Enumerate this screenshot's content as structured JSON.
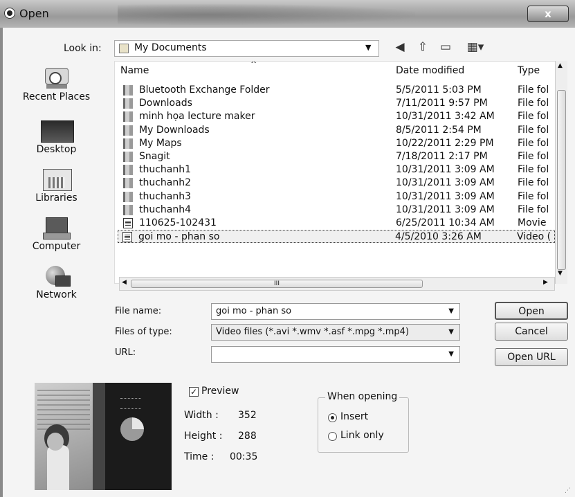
{
  "window": {
    "title": "Open",
    "close_label": "x"
  },
  "look_in": {
    "label": "Look in:",
    "value": "My Documents"
  },
  "toolbar": {
    "icons": [
      "back-icon",
      "up-folder-icon",
      "new-folder-icon",
      "view-menu-icon"
    ]
  },
  "places": [
    {
      "label": "Recent Places",
      "icon": "recent-places-icon"
    },
    {
      "label": "Desktop",
      "icon": "desktop-icon"
    },
    {
      "label": "Libraries",
      "icon": "libraries-icon"
    },
    {
      "label": "Computer",
      "icon": "computer-icon"
    },
    {
      "label": "Network",
      "icon": "network-icon"
    }
  ],
  "file_list": {
    "columns": [
      "Name",
      "Date modified",
      "Type"
    ],
    "rows": [
      {
        "name": "Bluetooth Exchange Folder",
        "date": "5/5/2011 5:03 PM",
        "type": "File fol",
        "kind": "folder"
      },
      {
        "name": "Downloads",
        "date": "7/11/2011 9:57 PM",
        "type": "File fol",
        "kind": "folder"
      },
      {
        "name": "minh họa lecture maker",
        "date": "10/31/2011 3:42 AM",
        "type": "File fol",
        "kind": "folder"
      },
      {
        "name": "My Downloads",
        "date": "8/5/2011 2:54 PM",
        "type": "File fol",
        "kind": "folder"
      },
      {
        "name": "My Maps",
        "date": "10/22/2011 2:29 PM",
        "type": "File fol",
        "kind": "folder"
      },
      {
        "name": "Snagit",
        "date": "7/18/2011 2:17 PM",
        "type": "File fol",
        "kind": "folder"
      },
      {
        "name": "thuchanh1",
        "date": "10/31/2011 3:09 AM",
        "type": "File fol",
        "kind": "folder"
      },
      {
        "name": "thuchanh2",
        "date": "10/31/2011 3:09 AM",
        "type": "File fol",
        "kind": "folder"
      },
      {
        "name": "thuchanh3",
        "date": "10/31/2011 3:09 AM",
        "type": "File fol",
        "kind": "folder"
      },
      {
        "name": "thuchanh4",
        "date": "10/31/2011 3:09 AM",
        "type": "File fol",
        "kind": "folder"
      },
      {
        "name": "110625-102431",
        "date": "6/25/2011 10:34 AM",
        "type": "Movie",
        "kind": "movie"
      },
      {
        "name": "goi mo - phan so",
        "date": "4/5/2010 3:26 AM",
        "type": "Video (",
        "kind": "movie",
        "selected": true
      }
    ],
    "hscroll_grip": "III"
  },
  "fields": {
    "file_name": {
      "label": "File name:",
      "value": "goi mo - phan so"
    },
    "file_type": {
      "label": "Files of type:",
      "value": "Video files (*.avi *.wmv *.asf *.mpg *.mp4)"
    },
    "url": {
      "label": "URL:",
      "value": ""
    }
  },
  "buttons": {
    "open": "Open",
    "cancel": "Cancel",
    "open_url": "Open URL"
  },
  "preview": {
    "checkbox_label": "Preview",
    "checked": true,
    "width_label": "Width :",
    "width_value": "352",
    "height_label": "Height :",
    "height_value": "288",
    "time_label": "Time :",
    "time_value": "00:35"
  },
  "when_opening": {
    "title": "When opening",
    "options": [
      {
        "label": "Insert",
        "selected": true
      },
      {
        "label": "Link only",
        "selected": false
      }
    ]
  }
}
